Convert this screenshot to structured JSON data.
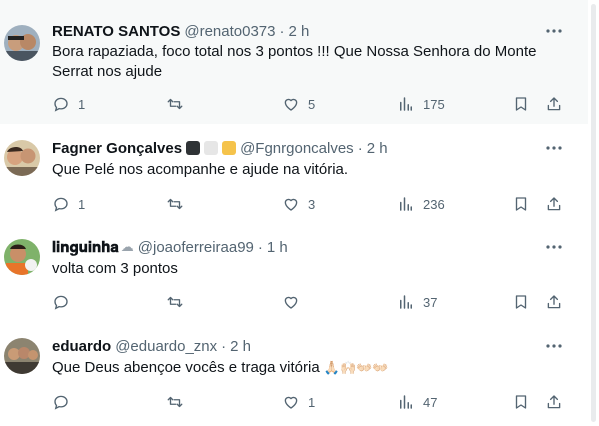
{
  "tweets": [
    {
      "name": "RENATO SANTOS",
      "handle": "@renato0373",
      "time": "2 h",
      "text": "Bora rapaziada, foco total nos 3 pontos !!! Que Nossa Senhora do Monte Serrat nos ajude",
      "replies": "1",
      "retweets": "",
      "likes": "5",
      "views": "175"
    },
    {
      "name": "Fagner Gonçalves",
      "badges": [
        "#2f3336",
        "#e6e6e6",
        "#f5c34b"
      ],
      "handle": "@Fgnrgoncalves",
      "time": "2 h",
      "text": "Que Pelé nos acompanhe e ajude na vitória.",
      "replies": "1",
      "retweets": "",
      "likes": "3",
      "views": "236"
    },
    {
      "name": "𝐥𝐢𝐧𝐠𝐮𝐢𝐧𝐡𝐚",
      "name_suffix": "☁",
      "handle": "@joaoferreiraa99",
      "time": "1 h",
      "text": "volta com 3 pontos",
      "replies": "",
      "retweets": "",
      "likes": "",
      "views": "37"
    },
    {
      "name": "eduardo",
      "handle": "@eduardo_znx",
      "time": "2 h",
      "text": "Que Deus abençoe vocês e traga vitória",
      "text_emoji": "🙏🏻🙌🏻👐🏻👐🏻",
      "replies": "",
      "retweets": "",
      "likes": "1",
      "views": "47"
    }
  ],
  "separator": "·",
  "icons": {
    "reply": "reply-icon",
    "retweet": "retweet-icon",
    "like": "heart-icon",
    "views": "views-icon",
    "bookmark": "bookmark-icon",
    "share": "share-icon",
    "more": "more-icon"
  },
  "colors": {
    "text": "#0f1419",
    "secondary": "#536471",
    "divider": "#eff3f4",
    "highlight_bg": "#f7f9f9"
  }
}
